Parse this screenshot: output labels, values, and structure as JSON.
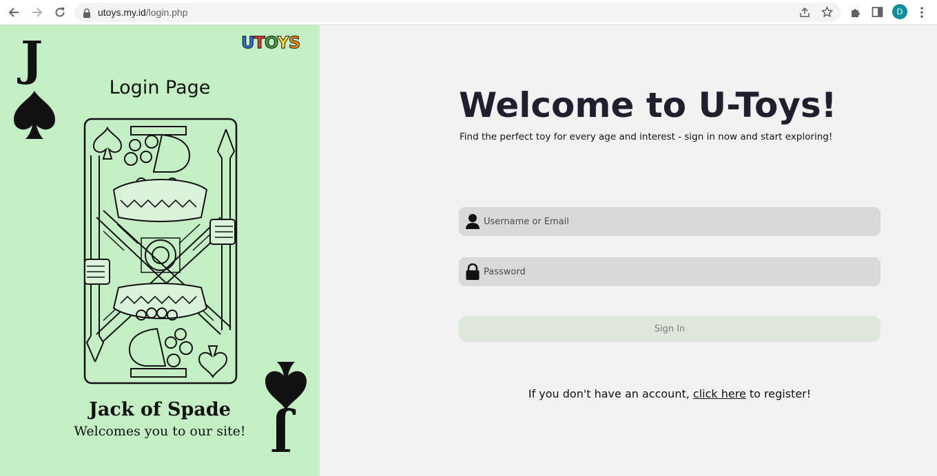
{
  "browser": {
    "url_domain": "utoys.my.id",
    "url_path": "/login.php",
    "profile_initial": "D"
  },
  "left_panel": {
    "logo_text": "UTOYS",
    "title": "Login Page",
    "corner_letter": "J",
    "card_title": "Jack of Spade",
    "card_subtitle": "Welcomes you to our site!"
  },
  "main": {
    "heading": "Welcome to U-Toys!",
    "tagline": "Find the perfect toy for every age and interest - sign in now and start exploring!",
    "username_placeholder": "Username or Email",
    "password_placeholder": "Password",
    "signin_label": "Sign In",
    "register_prefix": "If you don't have an account, ",
    "register_link": "click here",
    "register_suffix": " to register!"
  },
  "colors": {
    "left_panel_bg": "#c4eec4",
    "page_bg": "#f2f2f2",
    "field_bg": "#d9d9d9",
    "signin_bg": "#dfe6dc"
  }
}
